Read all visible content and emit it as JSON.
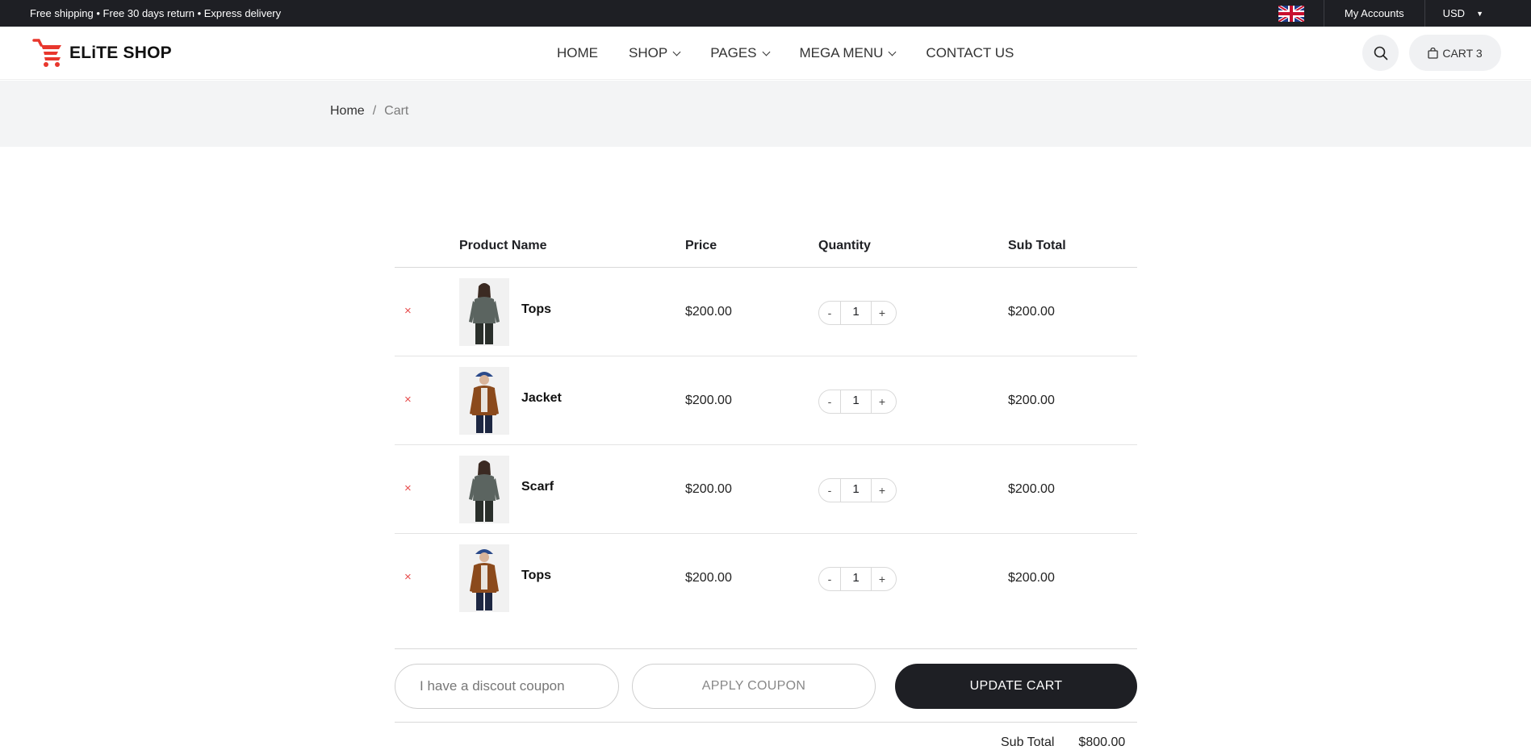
{
  "topbar": {
    "promo": "Free shipping • Free 30 days return • Express delivery",
    "account_label": "My Accounts",
    "currency": "USD"
  },
  "header": {
    "logo_text": "ELiTE SHOP",
    "nav": [
      {
        "label": "HOME",
        "has_dropdown": false
      },
      {
        "label": "SHOP",
        "has_dropdown": true
      },
      {
        "label": "PAGES",
        "has_dropdown": true
      },
      {
        "label": "MEGA MENU",
        "has_dropdown": true
      },
      {
        "label": "CONTACT US",
        "has_dropdown": false
      }
    ],
    "cart_label": "CART 3",
    "brand_color": "#e8372d"
  },
  "breadcrumb": {
    "home": "Home",
    "separator": "/",
    "current": "Cart"
  },
  "cart": {
    "columns": {
      "name": "Product Name",
      "price": "Price",
      "quantity": "Quantity",
      "subtotal": "Sub Total"
    },
    "rows": [
      {
        "name": "Tops",
        "price": "$200.00",
        "qty": "1",
        "subtotal": "$200.00",
        "image": "woman-grey-top"
      },
      {
        "name": "Jacket",
        "price": "$200.00",
        "qty": "1",
        "subtotal": "$200.00",
        "image": "woman-brown-jacket"
      },
      {
        "name": "Scarf",
        "price": "$200.00",
        "qty": "1",
        "subtotal": "$200.00",
        "image": "woman-grey-top"
      },
      {
        "name": "Tops",
        "price": "$200.00",
        "qty": "1",
        "subtotal": "$200.00",
        "image": "woman-brown-jacket"
      }
    ],
    "remove_symbol": "×",
    "minus": "-",
    "plus": "+"
  },
  "coupon": {
    "placeholder": "I have a discout coupon",
    "apply_label": "APPLY COUPON",
    "update_label": "UPDATE CART"
  },
  "totals": {
    "subtotal_label": "Sub Total",
    "subtotal_value": "$800.00"
  }
}
